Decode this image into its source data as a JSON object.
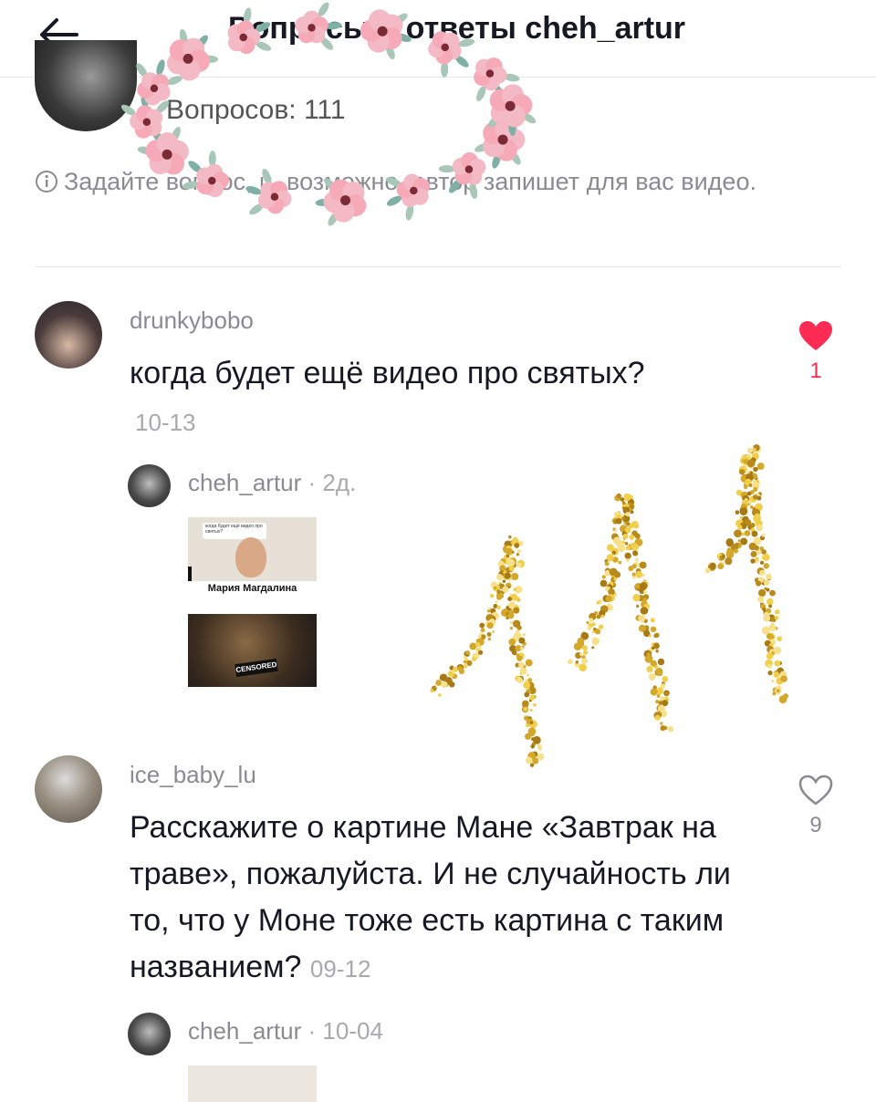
{
  "header": {
    "title": "Вопросы и ответы cheh_artur",
    "back_icon": "arrow-left-icon"
  },
  "profile": {
    "questions_label": "Вопросов: 111",
    "info_text": "Задайте вопрос, и, возможно, автор запишет для вас видео."
  },
  "comments": [
    {
      "username": "drunkybobo",
      "text": "когда будет ещё видео про святых?",
      "date": "10-13",
      "likes": "1",
      "liked": true,
      "reply": {
        "username": "cheh_artur",
        "meta": " · 2д.",
        "video_caption": "Мария Магдалина",
        "video_bubble": "когда будет ещё видео про святых?",
        "video_badge": "CENSORED"
      }
    },
    {
      "username": "ice_baby_lu",
      "text": "Расскажите о картине Мане «Завтрак на траве», пожалуйста. И не случайность ли то, что у Моне тоже есть картина с таким названием?",
      "date": "09-12",
      "likes": "9",
      "liked": false,
      "reply": {
        "username": "cheh_artur",
        "meta": " · 10-04"
      }
    }
  ],
  "colors": {
    "like_active": "#fe2c55",
    "text_primary": "#161823",
    "text_secondary": "#8a8b91"
  }
}
